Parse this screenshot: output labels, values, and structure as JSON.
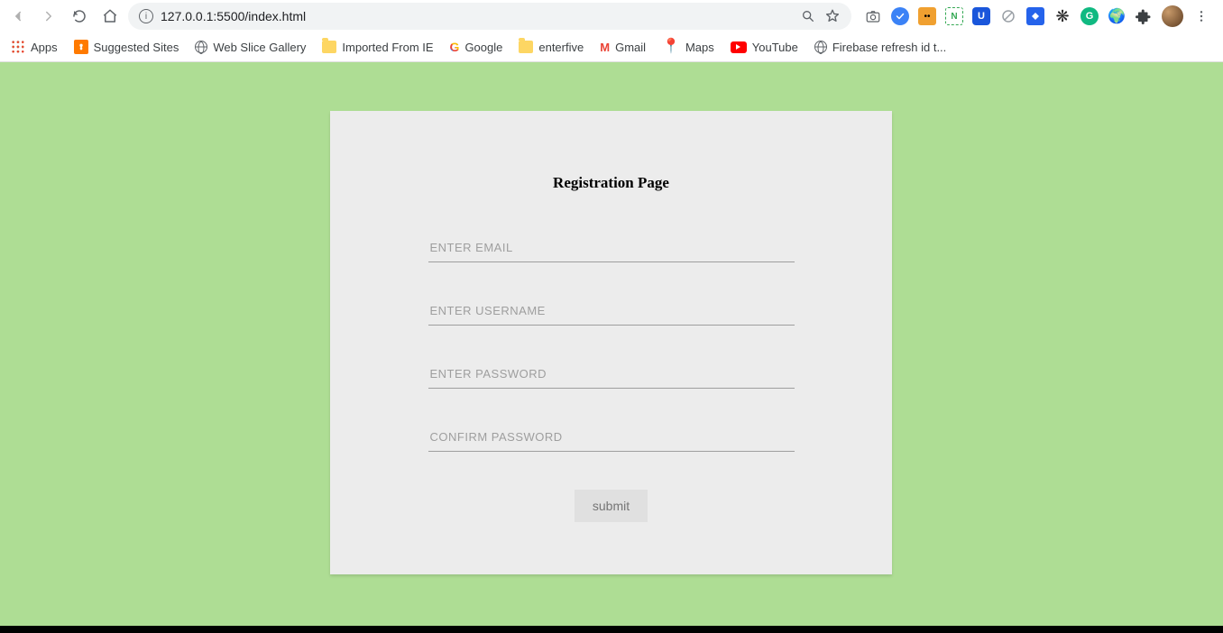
{
  "browser": {
    "url": "127.0.0.1:5500/index.html",
    "bookmarks": [
      {
        "label": "Apps",
        "icon": "apps"
      },
      {
        "label": "Suggested Sites",
        "icon": "orange-square"
      },
      {
        "label": "Web Slice Gallery",
        "icon": "globe"
      },
      {
        "label": "Imported From IE",
        "icon": "folder"
      },
      {
        "label": "Google",
        "icon": "g-logo"
      },
      {
        "label": "enterfive",
        "icon": "folder"
      },
      {
        "label": "Gmail",
        "icon": "gmail"
      },
      {
        "label": "Maps",
        "icon": "maps"
      },
      {
        "label": "YouTube",
        "icon": "youtube"
      },
      {
        "label": "Firebase refresh id t...",
        "icon": "globe"
      }
    ]
  },
  "form": {
    "title": "Registration Page",
    "email_placeholder": "ENTER EMAIL",
    "username_placeholder": "ENTER USERNAME",
    "password_placeholder": "ENTER PASSWORD",
    "confirm_placeholder": "CONFIRM PASSWORD",
    "submit_label": "submit"
  }
}
